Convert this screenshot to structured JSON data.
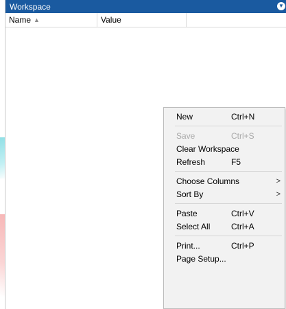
{
  "panel": {
    "title": "Workspace",
    "title_action_icon": "collapse-arrow-icon"
  },
  "table": {
    "columns": [
      {
        "label": "Name",
        "sort_icon": "sort-ascending-icon"
      },
      {
        "label": "Value"
      },
      {
        "label": ""
      }
    ],
    "rows": []
  },
  "context_menu": {
    "items": [
      {
        "label": "New",
        "shortcut": "Ctrl+N",
        "enabled": true
      },
      {
        "label": "Save",
        "shortcut": "Ctrl+S",
        "enabled": false
      },
      {
        "label": "Clear Workspace",
        "shortcut": "",
        "enabled": true
      },
      {
        "label": "Refresh",
        "shortcut": "F5",
        "enabled": true
      },
      {
        "label": "Choose Columns",
        "submenu": true,
        "enabled": true
      },
      {
        "label": "Sort By",
        "submenu": true,
        "enabled": true
      },
      {
        "label": "Paste",
        "shortcut": "Ctrl+V",
        "enabled": true
      },
      {
        "label": "Select All",
        "shortcut": "Ctrl+A",
        "enabled": true
      },
      {
        "label": "Print...",
        "shortcut": "Ctrl+P",
        "enabled": true
      },
      {
        "label": "Page Setup...",
        "shortcut": "",
        "enabled": true
      }
    ],
    "submenu_arrow": ">"
  },
  "colors": {
    "titlebar": "#1a5aa0",
    "menu_background": "#f2f2f2",
    "disabled_text": "#a9a9a9"
  }
}
